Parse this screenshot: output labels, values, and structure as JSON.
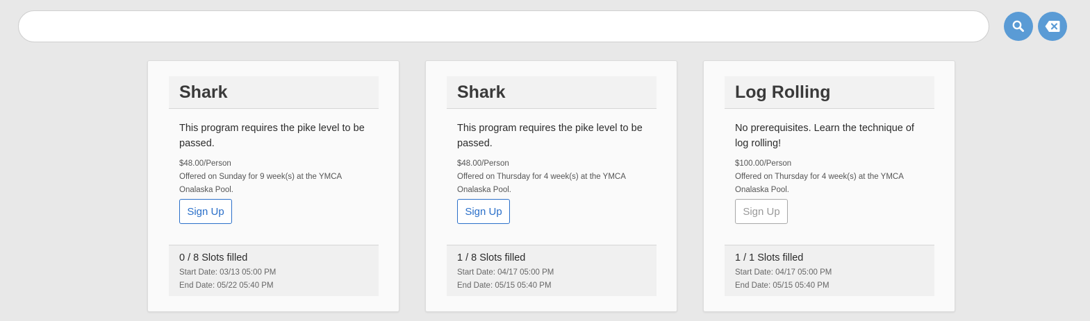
{
  "search": {
    "value": "",
    "placeholder": ""
  },
  "buttons": {
    "search_icon": "search-icon",
    "clear_icon": "backspace-icon",
    "accent_color": "#5a9bd5"
  },
  "cards": [
    {
      "title": "Shark",
      "description": "This program requires the pike level to be passed.",
      "price": "$48.00/Person",
      "offered": "Offered on Sunday for 9 week(s) at the YMCA Onalaska Pool.",
      "signup_label": "Sign Up",
      "signup_enabled": true,
      "slots": "0 / 8 Slots filled",
      "start_date": "Start Date: 03/13 05:00 PM",
      "end_date": "End Date: 05/22 05:40 PM"
    },
    {
      "title": "Shark",
      "description": "This program requires the pike level to be passed.",
      "price": "$48.00/Person",
      "offered": "Offered on Thursday for 4 week(s) at the YMCA Onalaska Pool.",
      "signup_label": "Sign Up",
      "signup_enabled": true,
      "slots": "1 / 8 Slots filled",
      "start_date": "Start Date: 04/17 05:00 PM",
      "end_date": "End Date: 05/15 05:40 PM"
    },
    {
      "title": "Log Rolling",
      "description": "No prerequisites. Learn the technique of log rolling!",
      "price": "$100.00/Person",
      "offered": "Offered on Thursday for 4 week(s) at the YMCA Onalaska Pool.",
      "signup_label": "Sign Up",
      "signup_enabled": false,
      "slots": "1 / 1 Slots filled",
      "start_date": "Start Date: 04/17 05:00 PM",
      "end_date": "End Date: 05/15 05:40 PM"
    }
  ]
}
